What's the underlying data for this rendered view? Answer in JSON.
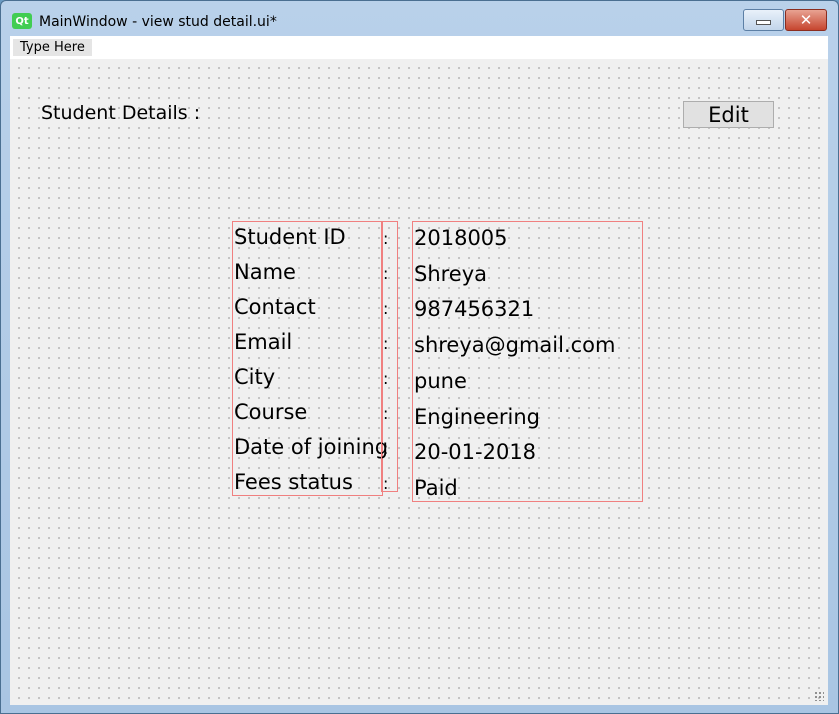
{
  "window": {
    "title": "MainWindow - view stud detail.ui*",
    "logo_text": "Qt",
    "close_symbol": "✕"
  },
  "menubar": {
    "placeholder_item": "Type Here"
  },
  "form": {
    "heading": "Student Details :",
    "edit_label": "Edit",
    "labels": [
      "Student ID",
      "Name",
      "Contact",
      "Email",
      "City",
      "Course",
      "Date of joining",
      "Fees status"
    ],
    "separator": ":",
    "values": [
      "2018005",
      "Shreya",
      "987456321",
      "shreya@gmail.com",
      "pune",
      "Engineering",
      "20-01-2018",
      "Paid"
    ]
  }
}
